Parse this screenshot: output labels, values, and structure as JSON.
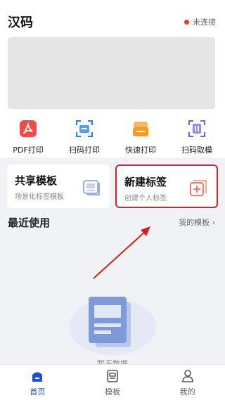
{
  "app": {
    "title": "汉码"
  },
  "connection": {
    "status": "未连接",
    "status_color": "#e53935"
  },
  "shortcuts": [
    {
      "label": "PDF打印",
      "icon": "pdf-icon",
      "color": "#ef4b4b"
    },
    {
      "label": "扫码打印",
      "icon": "scan-print-icon",
      "color": "#2f7cf6"
    },
    {
      "label": "快速打印",
      "icon": "quick-print-icon",
      "color": "#f59a23"
    },
    {
      "label": "扫码取模",
      "icon": "scan-template-icon",
      "color": "#7a5ce6"
    }
  ],
  "cards": {
    "share": {
      "title": "共享模板",
      "subtitle": "场景化标签模板",
      "icon": "template-gallery-icon"
    },
    "new": {
      "title": "新建标签",
      "subtitle": "创建个人标签",
      "icon": "add-label-icon",
      "highlight_color": "#e02020"
    }
  },
  "recent": {
    "title": "最近使用",
    "more_label": "我的模板"
  },
  "empty": {
    "text": "暂无数据"
  },
  "tabbar": [
    {
      "label": "首页",
      "icon": "home-icon",
      "active": true
    },
    {
      "label": "模板",
      "icon": "template-icon",
      "active": false
    },
    {
      "label": "我的",
      "icon": "profile-icon",
      "active": false
    }
  ],
  "accent": "#1a4fd6"
}
